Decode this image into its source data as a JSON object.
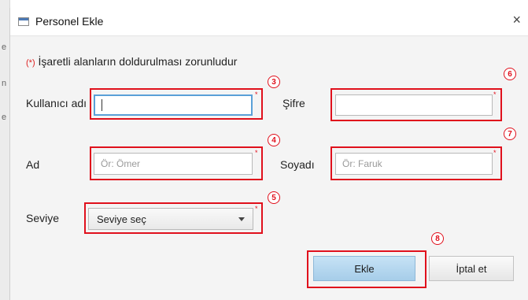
{
  "window": {
    "title": "Personel Ekle",
    "close_glyph": "×"
  },
  "note": {
    "mark": "(*)",
    "text": "İşaretli alanların doldurulması zorunludur"
  },
  "form": {
    "username_label": "Kullanıcı adı",
    "username_value": "",
    "password_label": "Şifre",
    "password_value": "",
    "name_label": "Ad",
    "name_placeholder": "Ör: Ömer",
    "surname_label": "Soyadı",
    "surname_placeholder": "Ör: Faruk",
    "level_label": "Seviye",
    "level_select_value": "Seviye seç",
    "required_star": "*"
  },
  "annotations": [
    "3",
    "4",
    "5",
    "6",
    "7",
    "8"
  ],
  "buttons": {
    "add": "Ekle",
    "cancel": "İptal et"
  },
  "background_strip": [
    "e",
    "n",
    "e"
  ],
  "colors": {
    "annotation_red": "#e0101c",
    "focus_blue": "#5aa0d8",
    "primary_button": "#b6d8ef"
  },
  "icons": {
    "window": "window-icon",
    "close": "close-icon",
    "dropdown": "chevron-down-icon"
  }
}
